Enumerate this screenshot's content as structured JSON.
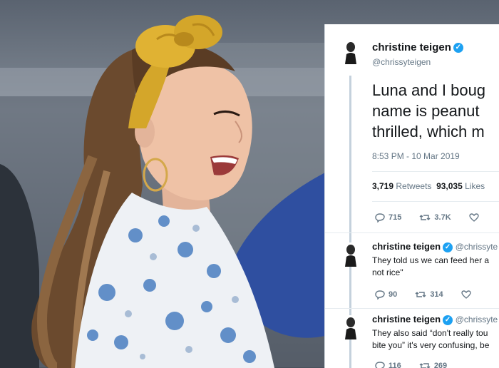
{
  "tweet": {
    "author_name": "christine teigen",
    "author_handle": "@chrissyteigen",
    "text_lines": [
      "Luna and I boug",
      "name is peanut",
      "thrilled, which m"
    ],
    "timestamp": "8:53 PM - 10 Mar 2019",
    "retweets_count": "3,719",
    "retweets_label": "Retweets",
    "likes_count": "93,035",
    "likes_label": "Likes",
    "reply_count": "715",
    "retweet_count": "3.7K"
  },
  "replies": [
    {
      "author_name": "christine teigen",
      "author_handle": "@chrissyte",
      "text_lines": [
        "They told us we can feed her a",
        "not rice\""
      ],
      "reply_count": "90",
      "retweet_count": "314"
    },
    {
      "author_name": "christine teigen",
      "author_handle": "@chrissyte",
      "text_lines": [
        "They also said “don't really tou",
        "bite you” it's very confusing, be"
      ],
      "reply_count": "116",
      "retweet_count": "269"
    }
  ],
  "colors": {
    "accent": "#1da1f2",
    "headband": "#d4a62a",
    "blouse_flowers": "#4a7fc1"
  }
}
